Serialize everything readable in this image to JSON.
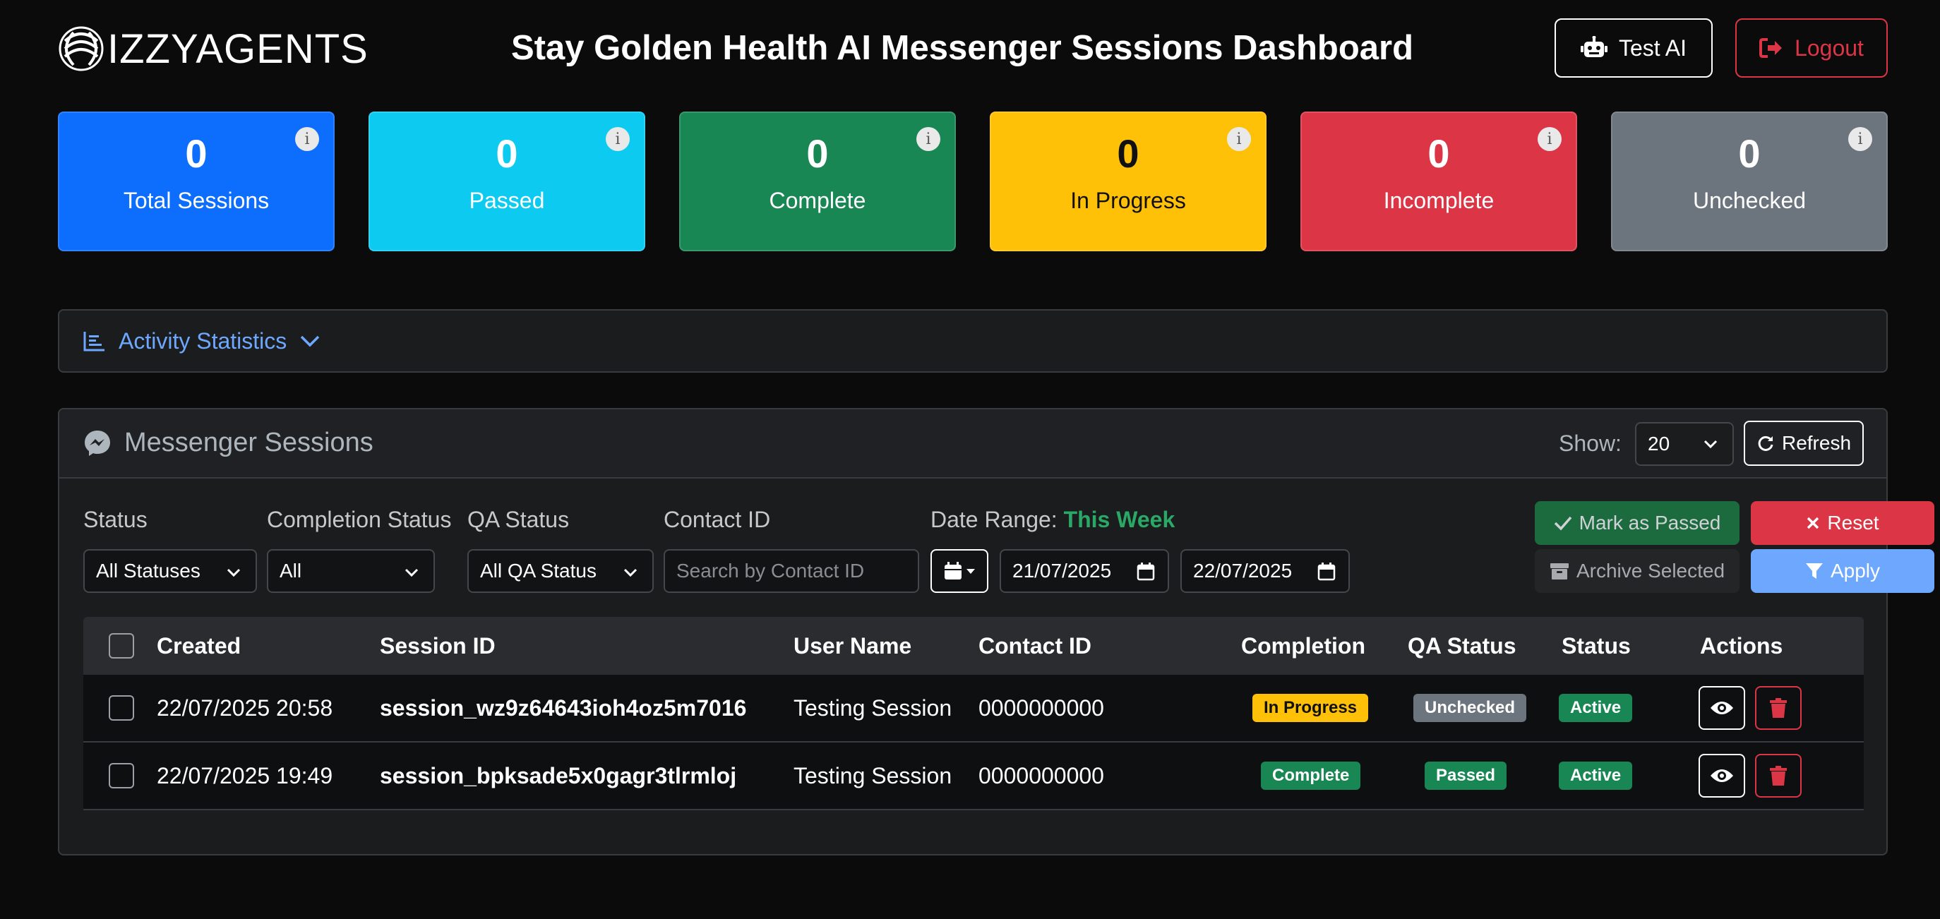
{
  "header": {
    "logo_text": "IZZYAGENTS",
    "title": "Stay Golden Health AI Messenger Sessions Dashboard",
    "test_ai_label": "Test AI",
    "logout_label": "Logout"
  },
  "stats": [
    {
      "value": "0",
      "label": "Total Sessions",
      "color": "#0d6efd",
      "text_color": "#ffffff"
    },
    {
      "value": "0",
      "label": "Passed",
      "color": "#0dcaf0",
      "text_color": "#ffffff"
    },
    {
      "value": "0",
      "label": "Complete",
      "color": "#198754",
      "text_color": "#ffffff"
    },
    {
      "value": "0",
      "label": "In Progress",
      "color": "#ffc107",
      "text_color": "#111111"
    },
    {
      "value": "0",
      "label": "Incomplete",
      "color": "#dc3545",
      "text_color": "#ffffff"
    },
    {
      "value": "0",
      "label": "Unchecked",
      "color": "#6c757d",
      "text_color": "#ffffff"
    }
  ],
  "activity": {
    "label": "Activity Statistics"
  },
  "sessions": {
    "title": "Messenger Sessions",
    "show_label": "Show:",
    "show_value": "20",
    "refresh_label": "Refresh"
  },
  "filters": {
    "status_label": "Status",
    "status_value": "All Statuses",
    "completion_label": "Completion Status",
    "completion_value": "All",
    "qa_label": "QA Status",
    "qa_value": "All QA Status",
    "contact_label": "Contact ID",
    "contact_placeholder": "Search by Contact ID",
    "date_label": "Date Range:",
    "date_preset": "This Week",
    "date_from": "21/07/2025",
    "date_to": "22/07/2025",
    "mark_passed_label": "Mark as Passed",
    "reset_label": "Reset",
    "archive_label": "Archive Selected",
    "apply_label": "Apply"
  },
  "table": {
    "headers": {
      "created": "Created",
      "session_id": "Session ID",
      "user_name": "User Name",
      "contact_id": "Contact ID",
      "completion": "Completion",
      "qa_status": "QA Status",
      "status": "Status",
      "actions": "Actions"
    },
    "rows": [
      {
        "created": "22/07/2025 20:58",
        "session_id": "session_wz9z64643ioh4oz5m7016",
        "user_name": "Testing Session",
        "contact_id": "0000000000",
        "completion": "In Progress",
        "qa_status": "Unchecked",
        "status": "Active"
      },
      {
        "created": "22/07/2025 19:49",
        "session_id": "session_bpksade5x0gagr3tlrmloj",
        "user_name": "Testing Session",
        "contact_id": "0000000000",
        "completion": "Complete",
        "qa_status": "Passed",
        "status": "Active"
      }
    ]
  }
}
